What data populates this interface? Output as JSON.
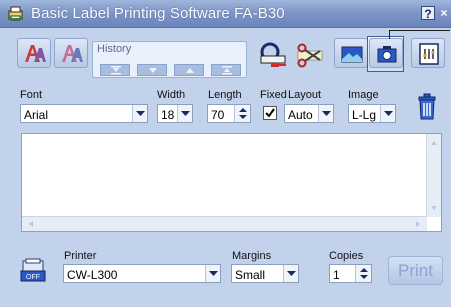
{
  "window": {
    "title": "Basic Label Printing Software FA-B30",
    "help_label": "?",
    "close_label": "×"
  },
  "toolbar": {
    "history_label": "History",
    "icons": [
      "label-a-icon",
      "label-b-icon",
      "history-first-icon",
      "history-prev-icon",
      "history-next-icon",
      "history-last-icon",
      "tape-cut-icon",
      "scissors-icon",
      "picture-icon",
      "camera-icon",
      "settings-icon"
    ]
  },
  "font": {
    "label": "Font",
    "value": "Arial"
  },
  "width": {
    "label": "Width",
    "value": "18"
  },
  "length": {
    "label": "Length",
    "value": "70"
  },
  "fixed": {
    "label": "Fixed",
    "checked": true
  },
  "layout": {
    "label": "Layout",
    "value": "Auto"
  },
  "image": {
    "label": "Image",
    "value": "L-Lg"
  },
  "printer": {
    "label": "Printer",
    "value": "CW-L300"
  },
  "margins": {
    "label": "Margins",
    "value": "Small"
  },
  "copies": {
    "label": "Copies",
    "value": "1"
  },
  "off_button": {
    "label": "OFF"
  },
  "print_button": {
    "label": "Print"
  },
  "colors": {
    "window_bg": "#c2d2ea",
    "titlebar": "#7f97c8",
    "print_text_disabled": "#8ba4d0"
  }
}
